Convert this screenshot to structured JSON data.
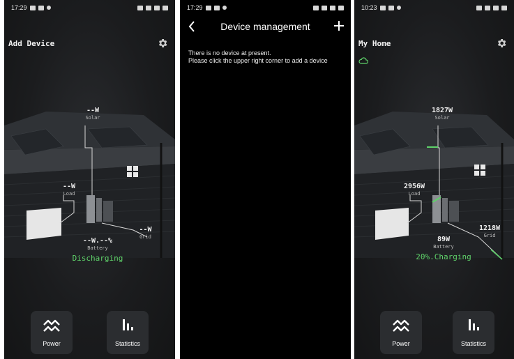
{
  "screen1": {
    "status": {
      "time": "17:29"
    },
    "title": "Add Device",
    "solar": {
      "value": "--W",
      "caption": "Solar"
    },
    "load": {
      "value": "--W",
      "caption": "Load"
    },
    "grid": {
      "value": "--W",
      "caption": "Grid"
    },
    "battery": {
      "value": "--W.--%",
      "caption": "Battery",
      "state": "Discharging"
    },
    "nav": {
      "power": "Power",
      "statistics": "Statistics"
    }
  },
  "screen2": {
    "status": {
      "time": "17:29"
    },
    "title": "Device management",
    "empty_line1": "There is no device at present.",
    "empty_line2": "Please click the upper right corner to add a device"
  },
  "screen3": {
    "status": {
      "time": "10:23"
    },
    "title": "My Home",
    "solar": {
      "value": "1827W",
      "caption": "Solar"
    },
    "load": {
      "value": "2956W",
      "caption": "Load"
    },
    "grid": {
      "value": "1218W",
      "caption": "Grid"
    },
    "battery": {
      "value": "89W",
      "caption": "Battery",
      "state": "20%.Charging"
    },
    "nav": {
      "power": "Power",
      "statistics": "Statistics"
    }
  },
  "colors": {
    "accent_green": "#5fd36a",
    "background": "#1b1c1e",
    "nav_button": "#2b2d30"
  },
  "icons": [
    "gear-icon",
    "back-chevron-icon",
    "plus-icon",
    "cloud-icon",
    "power-icon",
    "statistics-icon"
  ]
}
